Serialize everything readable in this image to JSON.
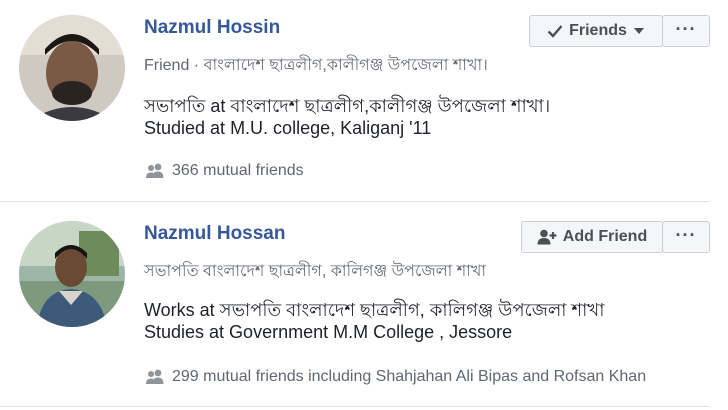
{
  "results": [
    {
      "name": "Nazmul Hossin",
      "subtitle": "Friend · বাংলাদেশ ছাত্রলীগ,কালীগঞ্জ উপজেলা শাখা।",
      "details": [
        "সভাপতি at বাংলাদেশ ছাত্রলীগ,কালীগঞ্জ উপজেলা শাখা।",
        "Studied at M.U. college, Kaliganj '11"
      ],
      "mutual": "366 mutual friends",
      "action_label": "Friends",
      "action_icon": "checkmark-icon",
      "more_label": "···"
    },
    {
      "name": "Nazmul Hossan",
      "subtitle": "সভাপতি বাংলাদেশ ছাত্রলীগ, কালিগঞ্জ উপজেলা শাখা",
      "details": [
        "Works at সভাপতি বাংলাদেশ ছাত্রলীগ, কালিগঞ্জ উপজেলা শাখা",
        "Studies at Government M.M College , Jessore"
      ],
      "mutual": "299 mutual friends including Shahjahan Ali Bipas and Rofsan Khan",
      "action_label": "Add Friend",
      "action_icon": "add-friend-icon",
      "more_label": "···"
    }
  ],
  "colors": {
    "link": "#365899",
    "secondary_text": "#606770",
    "button_bg": "#f5f6f7",
    "border": "#ccd0d5"
  }
}
